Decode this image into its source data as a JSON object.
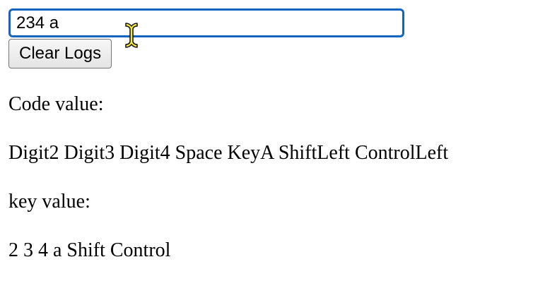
{
  "input": {
    "value": "234 a"
  },
  "clear_button": {
    "label": "Clear Logs"
  },
  "code": {
    "label": "Code value:",
    "value": "Digit2 Digit3 Digit4 Space KeyA ShiftLeft ControlLeft"
  },
  "key": {
    "label": "key value:",
    "value": "2 3 4 a Shift Control"
  },
  "colors": {
    "input_focus_border": "#1565c0",
    "cursor_fill": "#f7ec3a"
  },
  "icons": {
    "mouse_cursor": "ibeam-text-cursor-icon"
  }
}
